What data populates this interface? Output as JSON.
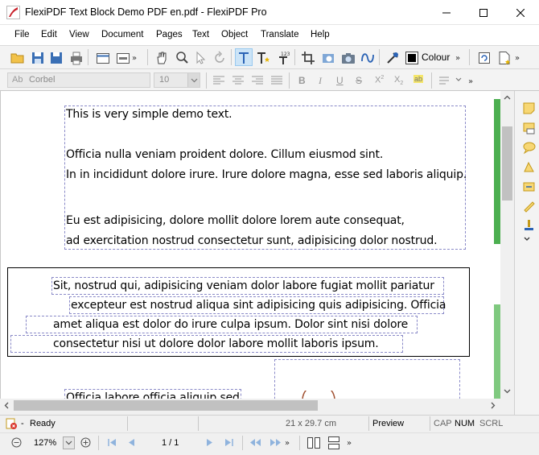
{
  "window": {
    "title": "FlexiPDF Text Block Demo PDF en.pdf - FlexiPDF Pro"
  },
  "menu": [
    "File",
    "Edit",
    "View",
    "Document",
    "Pages",
    "Text",
    "Object",
    "Translate",
    "Help"
  ],
  "toolbar": {
    "colour_label": "Colour",
    "more": "»"
  },
  "format_bar": {
    "font_prefix": "Ab",
    "font_name": "Corbel",
    "font_size": "10",
    "bold": "B",
    "italic": "I",
    "underline": "U",
    "strikethrough": "S",
    "superscript": "X",
    "superscript_mark": "2",
    "subscript": "X",
    "subscript_mark": "2",
    "highlight": "ab"
  },
  "document": {
    "block1": [
      "This is very simple demo text.",
      "Officia nulla veniam proident dolore. Cillum eiusmod sint.",
      "In in incididunt dolore irure. Irure dolore magna, esse sed laboris aliquip.",
      "Eu est adipisicing, dolore mollit dolore lorem aute consequat,",
      "ad exercitation nostrud consectetur sunt, adipisicing dolor nostrud."
    ],
    "block2": [
      "Sit, nostrud qui, adipisicing veniam dolor labore fugiat mollit pariatur",
      "excepteur est nostrud aliqua sint adipisicing quis adipisicing. Officia",
      "amet aliqua est dolor do irure culpa ipsum. Dolor sint nisi dolore",
      "consectetur nisi ut dolore dolor labore mollit laboris ipsum."
    ],
    "block3_partial": "Officia labore officia aliquip sed"
  },
  "status": {
    "separator": "-",
    "state": "Ready",
    "page_size": "21 x 29.7 cm",
    "mode": "Preview",
    "cap": "CAP",
    "num": "NUM",
    "scrl": "SCRL"
  },
  "nav": {
    "zoom": "127%",
    "page": "1 / 1"
  },
  "colors": {
    "accent_green": "#4caf50",
    "select_blue": "#cce4f7",
    "dashed_border": "#8a8ac8"
  }
}
